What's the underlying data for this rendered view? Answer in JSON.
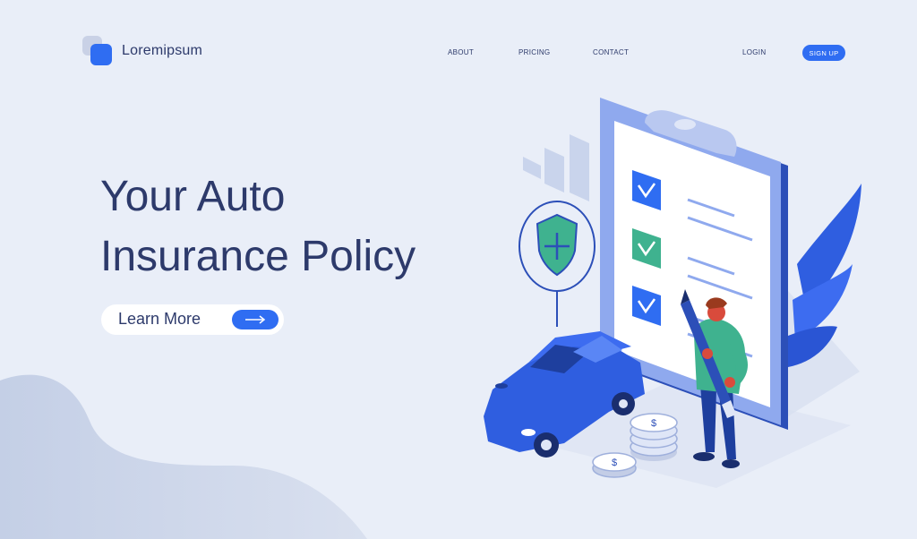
{
  "brand": {
    "name": "Loremipsum"
  },
  "nav": {
    "about": "ABOUT",
    "pricing": "PRICING",
    "contact": "CONTACT",
    "login": "LOGIN",
    "signup": "SIGN UP"
  },
  "hero": {
    "title_line1": "Your Auto",
    "title_line2": "Insurance Policy",
    "cta_label": "Learn More"
  },
  "colors": {
    "background": "#e9eef8",
    "primary": "#2f6df2",
    "text": "#2d3a6b",
    "accent_green": "#3fb28f"
  },
  "icons": {
    "cta": "arrow-right-icon",
    "shield": "shield-plus-icon",
    "checks": "check-icon"
  }
}
